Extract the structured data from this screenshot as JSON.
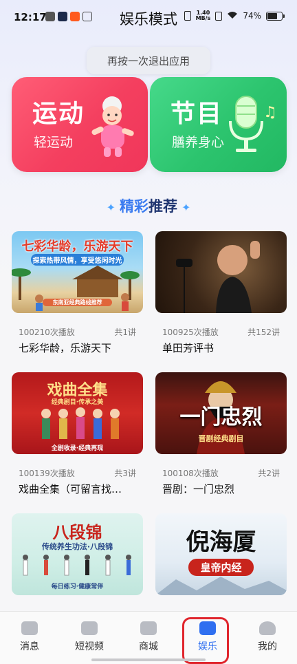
{
  "status": {
    "time": "12:17",
    "net_speed_value": "1.40",
    "net_speed_unit": "MB/s",
    "battery": "74%"
  },
  "header": {
    "title": "娱乐模式"
  },
  "toast": {
    "text": "再按一次退出应用"
  },
  "features": [
    {
      "title": "运动",
      "subtitle": "轻运动",
      "color": "#f43f5f"
    },
    {
      "title": "节目",
      "subtitle": "膳养身心",
      "color": "#2cc46e"
    }
  ],
  "section": {
    "title_a": "精彩",
    "title_b": "推荐"
  },
  "recommendations": [
    {
      "plays": "100210次播放",
      "episodes": "共1讲",
      "name": "七彩华龄，乐游天下",
      "thumb_title": "七彩华龄，乐游天下",
      "thumb_sub": "探索热带风情，享受悠闲时光",
      "thumb_tag": "东南亚经典路线推荐"
    },
    {
      "plays": "100925次播放",
      "episodes": "共152讲",
      "name": "单田芳评书"
    },
    {
      "plays": "100139次播放",
      "episodes": "共3讲",
      "name": "戏曲全集（可留言找…",
      "thumb_title": "戏曲全集",
      "thumb_sub": "经典剧目·传承之美",
      "thumb_tag": "全剧收录·经典再现"
    },
    {
      "plays": "100108次播放",
      "episodes": "共2讲",
      "name": "晋剧：一门忠烈",
      "thumb_title": "一门忠烈",
      "thumb_sub": "晋剧经典剧目"
    },
    {
      "thumb_title": "八段锦",
      "thumb_sub": "传统养生功法·八段锦",
      "thumb_tag": "每日练习·健康常伴"
    },
    {
      "thumb_title": "倪海厦",
      "thumb_sub": "皇帝内经"
    }
  ],
  "nav": [
    {
      "label": "消息",
      "icon": "message-icon"
    },
    {
      "label": "短视频",
      "icon": "video-icon"
    },
    {
      "label": "商城",
      "icon": "shop-icon"
    },
    {
      "label": "娱乐",
      "icon": "entertainment-icon",
      "active": true
    },
    {
      "label": "我的",
      "icon": "profile-icon"
    }
  ],
  "colors": {
    "accent": "#2f6ff0",
    "highlight": "#e0262d"
  }
}
